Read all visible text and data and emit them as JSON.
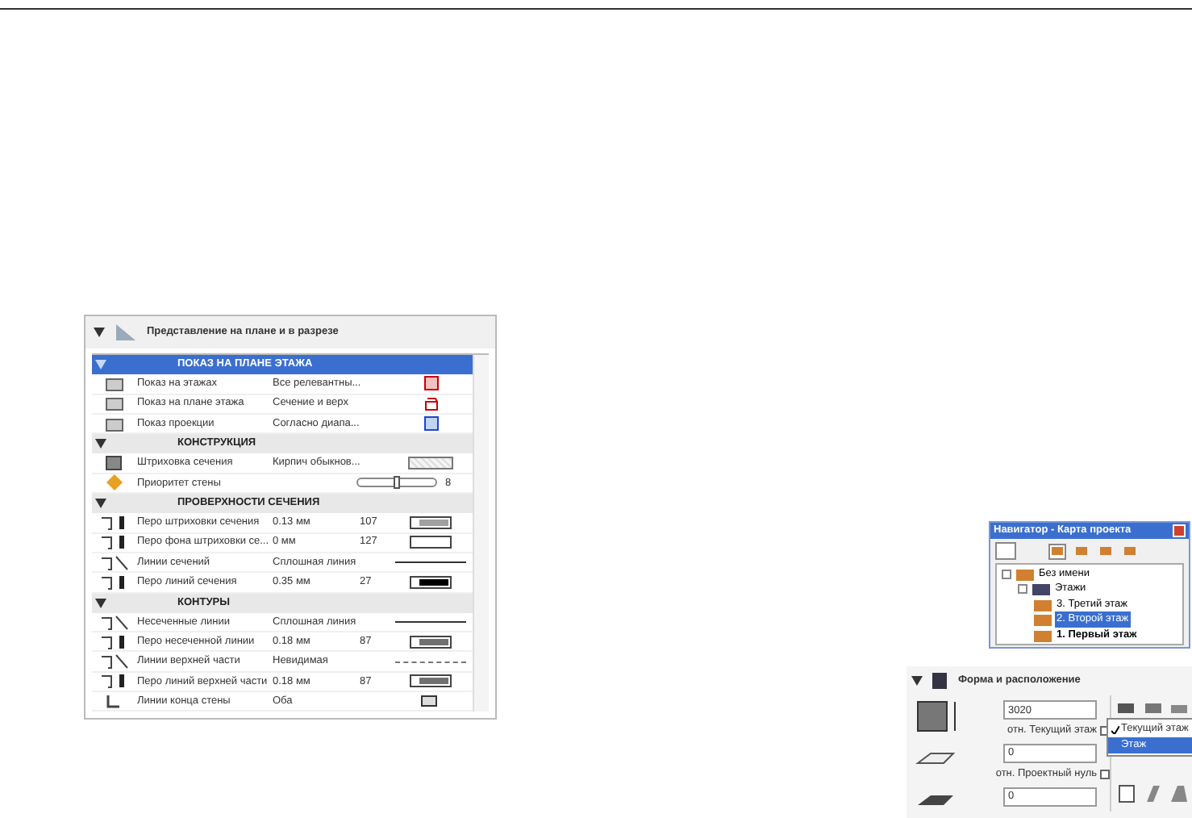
{
  "panel": {
    "title": "Представление на плане и в разрезе",
    "expanded": true,
    "groups": [
      {
        "title": "ПОКАЗ НА ПЛАНЕ ЭТАЖА",
        "selected": true,
        "expanded": true,
        "rows": [
          {
            "kind": "stories",
            "label": "Показ на этажах",
            "value": "Все релевантны..."
          },
          {
            "kind": "plan",
            "label": "Показ на плане этажа",
            "value": "Сечение и верх"
          },
          {
            "kind": "projection",
            "label": "Показ проекции",
            "value": "Согласно диапа..."
          }
        ]
      },
      {
        "title": "КОНСТРУКЦИЯ",
        "selected": false,
        "expanded": true,
        "rows": [
          {
            "kind": "fill",
            "label": "Штриховка сечения",
            "value": "Кирпич обыкнов..."
          },
          {
            "kind": "slider",
            "label": "Приоритет стены",
            "level": 0.45,
            "reading": "8"
          }
        ]
      },
      {
        "title": "ПРОВЕРХНОСТИ СЕЧЕНИЯ",
        "selected": false,
        "expanded": true,
        "rows": [
          {
            "kind": "pen",
            "label": "Перо штриховки сечения",
            "value": "0.13 мм",
            "pen": "107",
            "color": "#a0a0a0"
          },
          {
            "kind": "pen",
            "label": "Перо фона штриховки се...",
            "value": "0 мм",
            "pen": "127",
            "color": "#ffffff"
          },
          {
            "kind": "line",
            "label": "Линии сечений",
            "value": "Сплошная линия",
            "dashed": false
          },
          {
            "kind": "pen",
            "label": "Перо линий сечения",
            "value": "0.35 мм",
            "pen": "27",
            "color": "#000000"
          }
        ]
      },
      {
        "title": "КОНТУРЫ",
        "selected": false,
        "expanded": true,
        "rows": [
          {
            "kind": "line",
            "label": "Несеченные линии",
            "value": "Сплошная линия",
            "dashed": false
          },
          {
            "kind": "pen",
            "label": "Перо несеченной линии",
            "value": "0.18 мм",
            "pen": "87",
            "color": "#707070"
          },
          {
            "kind": "line",
            "label": "Линии верхней части",
            "value": "Невидимая",
            "dashed": true
          },
          {
            "kind": "pen",
            "label": "Перо линий верхней части",
            "value": "0.18 мм",
            "pen": "87",
            "color": "#707070"
          },
          {
            "kind": "end",
            "label": "Линии конца стены",
            "value": "Оба"
          }
        ]
      }
    ]
  },
  "navigator": {
    "title": "Навигатор - Карта проекта",
    "tree": [
      {
        "label": "Без имени",
        "selected": false,
        "children": [
          {
            "label": "Этажи",
            "selected": false,
            "children": [
              {
                "label": "3. Третий этаж",
                "selected": false
              },
              {
                "label": "2. Второй этаж",
                "selected": true
              },
              {
                "label": "1. Первый этаж",
                "selected": false
              }
            ]
          }
        ]
      }
    ]
  },
  "form": {
    "title": "Форма и расположение",
    "expanded": true,
    "fields": [
      {
        "value": "3020",
        "label": "отн. Текущий этаж"
      },
      {
        "value": "0",
        "label": "отн. Проектный нуль"
      },
      {
        "value": "0"
      }
    ],
    "menu": [
      {
        "label": "Текущий этаж",
        "checked": true,
        "selected": false
      },
      {
        "label": "Этаж",
        "checked": false,
        "selected": true
      }
    ]
  }
}
